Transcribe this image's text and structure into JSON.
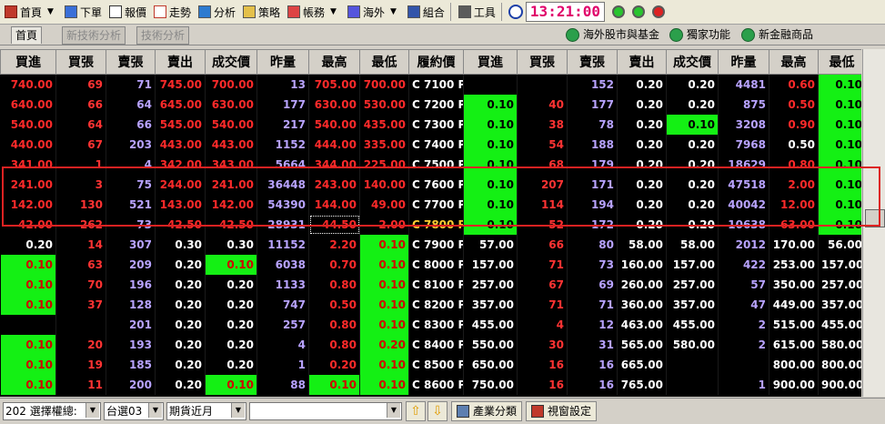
{
  "toolbar": {
    "items": [
      {
        "label": "首頁",
        "icon": "home-icon",
        "dropdown": true
      },
      {
        "label": "下單",
        "icon": "order-icon"
      },
      {
        "label": "報價",
        "icon": "quote-icon"
      },
      {
        "label": "走勢",
        "icon": "trend-icon"
      },
      {
        "label": "分析",
        "icon": "analysis-icon"
      },
      {
        "label": "策略",
        "icon": "strategy-icon"
      },
      {
        "label": "帳務",
        "icon": "account-icon",
        "dropdown": true
      },
      {
        "label": "海外",
        "icon": "overseas-icon",
        "dropdown": true
      },
      {
        "label": "組合",
        "icon": "combo-icon"
      },
      {
        "label": "工具",
        "icon": "tool-icon"
      }
    ],
    "clock": "13:21:00"
  },
  "tabs": {
    "left": [
      "首頁",
      "新技術分析",
      "技術分析"
    ],
    "right": [
      "海外股市與基金",
      "獨家功能",
      "新金融商品"
    ]
  },
  "table": {
    "headers": [
      "買進",
      "買張",
      "賣張",
      "賣出",
      "成交價",
      "昨量",
      "最高",
      "最低",
      "履約價",
      "買進",
      "買張",
      "賣張",
      "賣出",
      "成交價",
      "昨量",
      "最高",
      "最低"
    ],
    "rows": [
      [
        "740.00",
        "69",
        "71",
        "745.00",
        "700.00",
        "13",
        "705.00",
        "700.00",
        "C 7100 P",
        "",
        "",
        "152",
        "0.20",
        "0.20",
        "4481",
        "0.60",
        "0.10"
      ],
      [
        "640.00",
        "66",
        "64",
        "645.00",
        "630.00",
        "177",
        "630.00",
        "530.00",
        "C 7200 P",
        "0.10",
        "40",
        "177",
        "0.20",
        "0.20",
        "875",
        "0.50",
        "0.10"
      ],
      [
        "540.00",
        "64",
        "66",
        "545.00",
        "540.00",
        "217",
        "540.00",
        "435.00",
        "C 7300 P",
        "0.10",
        "38",
        "78",
        "0.20",
        "0.10",
        "3208",
        "0.90",
        "0.10"
      ],
      [
        "440.00",
        "67",
        "203",
        "443.00",
        "443.00",
        "1152",
        "444.00",
        "335.00",
        "C 7400 P",
        "0.10",
        "54",
        "188",
        "0.20",
        "0.20",
        "7968",
        "0.50",
        "0.10"
      ],
      [
        "341.00",
        "1",
        "4",
        "342.00",
        "343.00",
        "5664",
        "344.00",
        "225.00",
        "C 7500 P",
        "0.10",
        "68",
        "179",
        "0.20",
        "0.20",
        "18629",
        "0.80",
        "0.10"
      ],
      [
        "241.00",
        "3",
        "75",
        "244.00",
        "241.00",
        "36448",
        "243.00",
        "140.00",
        "C 7600 P",
        "0.10",
        "207",
        "171",
        "0.20",
        "0.20",
        "47518",
        "2.00",
        "0.10"
      ],
      [
        "142.00",
        "130",
        "521",
        "143.00",
        "142.00",
        "54390",
        "144.00",
        "49.00",
        "C 7700 P",
        "0.10",
        "114",
        "194",
        "0.20",
        "0.20",
        "40042",
        "12.00",
        "0.10"
      ],
      [
        "42.00",
        "262",
        "73",
        "42.50",
        "42.50",
        "28931",
        "44.50",
        "2.00",
        "C 7800 P",
        "0.10",
        "52",
        "172",
        "0.20",
        "0.20",
        "10638",
        "63.00",
        "0.10"
      ],
      [
        "0.20",
        "14",
        "307",
        "0.30",
        "0.30",
        "11152",
        "2.20",
        "0.10",
        "C 7900 P",
        "57.00",
        "66",
        "80",
        "58.00",
        "58.00",
        "2012",
        "170.00",
        "56.00"
      ],
      [
        "0.10",
        "63",
        "209",
        "0.20",
        "0.10",
        "6038",
        "0.70",
        "0.10",
        "C 8000 P",
        "157.00",
        "71",
        "73",
        "160.00",
        "157.00",
        "422",
        "253.00",
        "157.00"
      ],
      [
        "0.10",
        "70",
        "196",
        "0.20",
        "0.20",
        "1133",
        "0.80",
        "0.10",
        "C 8100 P",
        "257.00",
        "67",
        "69",
        "260.00",
        "257.00",
        "57",
        "350.00",
        "257.00"
      ],
      [
        "0.10",
        "37",
        "128",
        "0.20",
        "0.20",
        "747",
        "0.50",
        "0.10",
        "C 8200 P",
        "357.00",
        "71",
        "71",
        "360.00",
        "357.00",
        "47",
        "449.00",
        "357.00"
      ],
      [
        "",
        "",
        "201",
        "0.20",
        "0.20",
        "257",
        "0.80",
        "0.10",
        "C 8300 P",
        "455.00",
        "4",
        "12",
        "463.00",
        "455.00",
        "2",
        "515.00",
        "455.00"
      ],
      [
        "0.10",
        "20",
        "193",
        "0.20",
        "0.20",
        "4",
        "0.80",
        "0.20",
        "C 8400 P",
        "550.00",
        "30",
        "31",
        "565.00",
        "580.00",
        "2",
        "615.00",
        "580.00"
      ],
      [
        "0.10",
        "19",
        "185",
        "0.20",
        "0.20",
        "1",
        "0.20",
        "0.10",
        "C 8500 P",
        "650.00",
        "16",
        "16",
        "665.00",
        "",
        "",
        "800.00",
        "800.00"
      ],
      [
        "0.10",
        "11",
        "200",
        "0.20",
        "0.10",
        "88",
        "0.10",
        "0.10",
        "C 8600 P",
        "750.00",
        "16",
        "16",
        "765.00",
        "",
        "1",
        "900.00",
        "900.00"
      ]
    ]
  },
  "bottombar": {
    "select1": "202 選擇權總:",
    "select2": "台選03",
    "select3": "期貨近月",
    "select4": "",
    "btn_industry": "產業分類",
    "btn_window": "視窗設定"
  },
  "colors": {
    "up_red": "#ff2a2a",
    "green_cell": "#14f014",
    "volume_purple": "#b8a3ff",
    "highlight_border": "#dd2222",
    "clock_text": "#e0006a"
  }
}
